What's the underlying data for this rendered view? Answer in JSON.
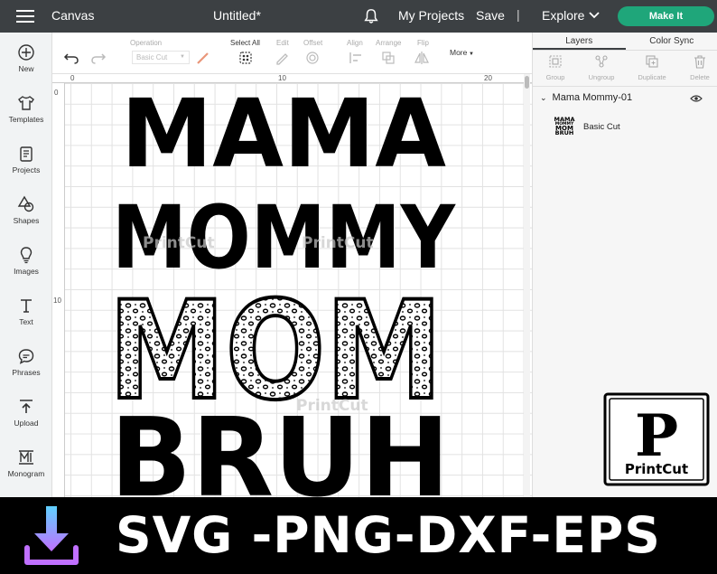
{
  "topbar": {
    "app_title": "Canvas",
    "doc_title": "Untitled*",
    "my_projects": "My Projects",
    "save": "Save",
    "separator": "|",
    "explore": "Explore",
    "make_it": "Make It",
    "make_it_color": "#1fa67a"
  },
  "sidebar": {
    "items": [
      {
        "label": "New",
        "icon": "plus-circle-icon"
      },
      {
        "label": "Templates",
        "icon": "shirt-icon"
      },
      {
        "label": "Projects",
        "icon": "projects-icon"
      },
      {
        "label": "Shapes",
        "icon": "shapes-icon"
      },
      {
        "label": "Images",
        "icon": "lightbulb-icon"
      },
      {
        "label": "Text",
        "icon": "text-icon"
      },
      {
        "label": "Phrases",
        "icon": "speech-bubble-icon"
      },
      {
        "label": "Upload",
        "icon": "upload-icon"
      },
      {
        "label": "Monogram",
        "icon": "monogram-icon"
      }
    ]
  },
  "toolbar": {
    "operation_label": "Operation",
    "operation_value": "Basic Cut",
    "select_all": "Select All",
    "edit": "Edit",
    "offset": "Offset",
    "align": "Align",
    "arrange": "Arrange",
    "flip": "Flip",
    "more": "More"
  },
  "ruler": {
    "top": [
      "0",
      "10",
      "20"
    ],
    "left": [
      "0",
      "10"
    ]
  },
  "artwork": {
    "lines": [
      "MAMA",
      "MOMMY",
      "MOM",
      "BRUH"
    ],
    "watermark": "PrintCut"
  },
  "right_panel": {
    "tabs": [
      "Layers",
      "Color Sync"
    ],
    "actions": [
      "Group",
      "Ungroup",
      "Duplicate",
      "Delete"
    ],
    "layer_group": "Mama Mommy-01",
    "layer_item": "Basic Cut",
    "thumb_lines": [
      "MAMA",
      "MOMMY",
      "MOM",
      "BRUH"
    ]
  },
  "logo": {
    "letter": "P",
    "name": "PrintCut"
  },
  "banner": {
    "text": "SVG -PNG-DXF-EPS"
  }
}
